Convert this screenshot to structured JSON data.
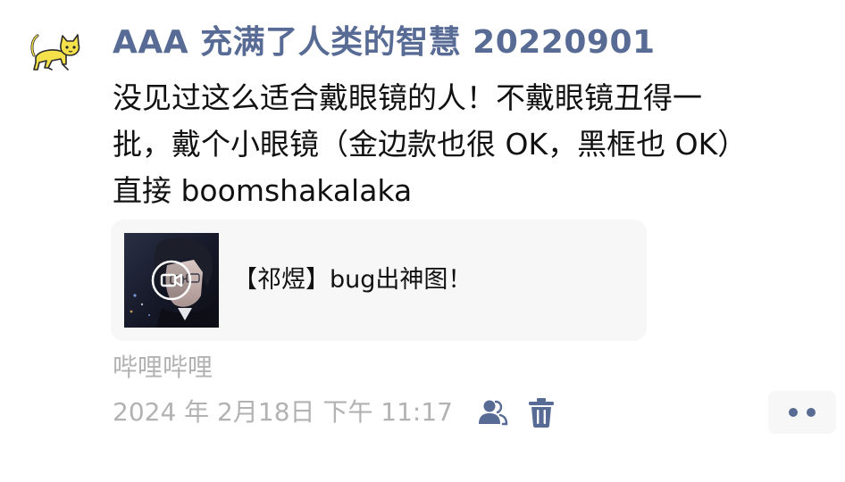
{
  "post": {
    "author": "AAA 充满了人类的智慧 20220901",
    "text_lines": [
      "没见过这么适合戴眼镜的人！不戴眼镜丑得一",
      "批，戴个小眼镜（金边款也很 OK，黑框也 OK）",
      "直接 boomshakalaka"
    ],
    "share": {
      "title": "【祁煜】bug出神图！",
      "thumbnail_icon": "video-camera-icon"
    },
    "source": "哔哩哔哩",
    "timestamp": "2024 年 2月18日 下午 11:17"
  },
  "icons": {
    "avatar": "yellow-cat-avatar",
    "privacy": "visible-to-some-icon",
    "delete": "trash-icon",
    "more": "more-dots-icon"
  },
  "colors": {
    "name": "#576b95",
    "text": "#111111",
    "meta": "#b2b2b2",
    "card_bg": "#f7f7f7",
    "avatar_yellow": "#f5e14a"
  }
}
